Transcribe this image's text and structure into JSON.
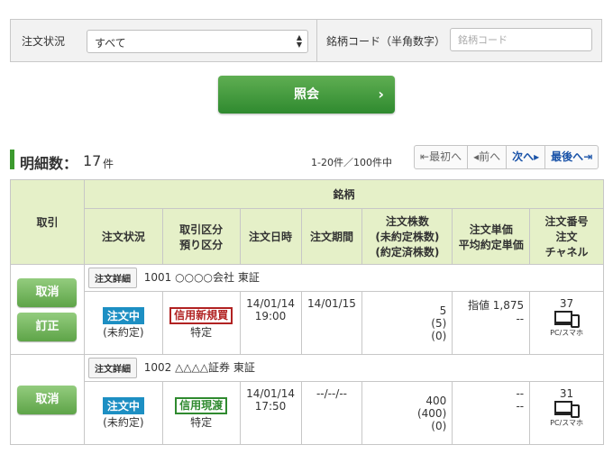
{
  "filter": {
    "status_label": "注文状況",
    "status_value": "すべて",
    "code_label": "銘柄コード（半角数字）",
    "code_placeholder": "銘柄コード"
  },
  "inquiry_label": "照会",
  "count": {
    "label": "明細数：",
    "value": "17",
    "unit": "件"
  },
  "range_text": "1-20件／100件中",
  "pager": {
    "first": "最初へ",
    "prev": "前へ",
    "next": "次へ",
    "last": "最後へ"
  },
  "table": {
    "h_torihiki": "取引",
    "h_meigara": "銘柄",
    "h_status": "注文状況",
    "h_kubun1": "取引区分",
    "h_kubun2": "預り区分",
    "h_datetime": "注文日時",
    "h_period": "注文期間",
    "h_qty1": "注文株数",
    "h_qty2": "(未約定株数)",
    "h_qty3": "(約定済株数)",
    "h_price1": "注文単価",
    "h_price2": "平均約定単価",
    "h_no1": "注文番号",
    "h_no2": "注文",
    "h_no3": "チャネル"
  },
  "orders": [
    {
      "buttons": [
        "取消",
        "訂正"
      ],
      "detail_label": "注文詳細",
      "issue": "1001 ○○○○会社 東証",
      "status": "注文中",
      "status_sub": "(未約定)",
      "kubun": "信用新規買",
      "azukari": "特定",
      "date": "14/01/14",
      "time": "19:00",
      "period": "14/01/15",
      "qty": "5",
      "qty_open": "(5)",
      "qty_done": "(0)",
      "price": "指値 1,875",
      "avg_price": "--",
      "order_no": "37",
      "channel": "PC/スマホ"
    },
    {
      "buttons": [
        "取消"
      ],
      "detail_label": "注文詳細",
      "issue": "1002 △△△△証券 東証",
      "status": "注文中",
      "status_sub": "(未約定)",
      "kubun": "信用現渡",
      "azukari": "特定",
      "date": "14/01/14",
      "time": "17:50",
      "period": "--/--/--",
      "qty": "400",
      "qty_open": "(400)",
      "qty_done": "(0)",
      "price": "--",
      "avg_price": "--",
      "order_no": "31",
      "channel": "PC/スマホ"
    }
  ],
  "colors": {
    "accent_green": "#3c9a2e",
    "header_bg": "#e5f0c8",
    "status_blue": "#1d8fc3",
    "red": "#b12222"
  }
}
